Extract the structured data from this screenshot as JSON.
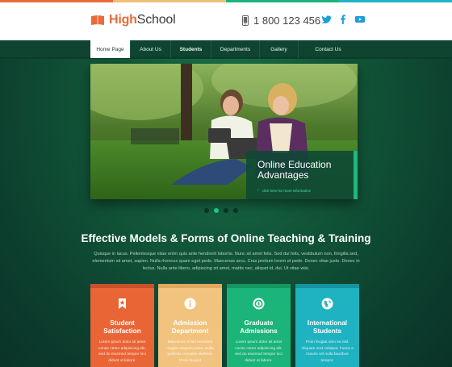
{
  "colors": {
    "stripe": [
      "#ea6a3a",
      "#f0c078",
      "#1db37d",
      "#22b3c8"
    ],
    "brand_orange": "#ea6a3a",
    "accent_green": "#1fb77e",
    "twitter_blue": "#1ea0d6"
  },
  "header": {
    "logo_high": "High",
    "logo_school": "School",
    "logo_icon": "book-icon",
    "phone": "1 800 123 456",
    "phone_icon": "phone-icon",
    "socials": [
      "twitter-icon",
      "facebook-icon",
      "youtube-icon"
    ]
  },
  "nav": {
    "items": [
      "Home Page",
      "About Us",
      "Students",
      "Departments",
      "Gallery",
      "Contact Us"
    ]
  },
  "slider": {
    "caption_title": "Online Education Advantages",
    "caption_link": "click here for more information",
    "dots": 4,
    "active_dot": 1
  },
  "section": {
    "title": "Effective Models & Forms of Online Teaching & Training",
    "text": "Quisque in lacus. Pellentesque vitae enim quis ante hendrerit lobortis. Nunc sit amet felis. Sed dui felis, vestibulum non, fringilla sed, elementum sit amet, sapien. Nulla rhoncus quam eget pede. Maecenas arcu. Cras pretium lorem et pede. Donec vitae justo. Donec in lectus. Nulla ante libero, adipiscing sit amet, mattis nec, aliquet id, dui. Ut vitae wisi."
  },
  "cards": [
    {
      "title": "Student Satisfaction",
      "icon": "bookmark-star-icon",
      "color": "#ea6536",
      "band": "#c9502a",
      "text": "Lorem ipsum dolor sit amet conse ctetur adipisicing elit, sed do eiusmod tempor inci didunt ut labore."
    },
    {
      "title": "Admission Department",
      "icon": "info-icon",
      "color": "#f1c37f",
      "band": "#e0a85d",
      "text": "Maecenas et leo hendrerit magna aliquam porta. Nulla pulvinar convallis eleifend. Proin feugiat"
    },
    {
      "title": "Graduate Admissions",
      "icon": "badge-icon",
      "color": "#1bb479",
      "band": "#15975f",
      "text": "Lorem ipsum dolor sit amet conse ctetur adipisicing elit, sed do eiusmod tempor inci didunt ut labore."
    },
    {
      "title": "International Students",
      "icon": "globe-icon",
      "color": "#1fb2c1",
      "band": "#1693a0",
      "text": "Proin feugiat sem eu nisl. Aliquam erat volutpat. Fusce a mauris vel nulla faucibus tempor."
    }
  ]
}
